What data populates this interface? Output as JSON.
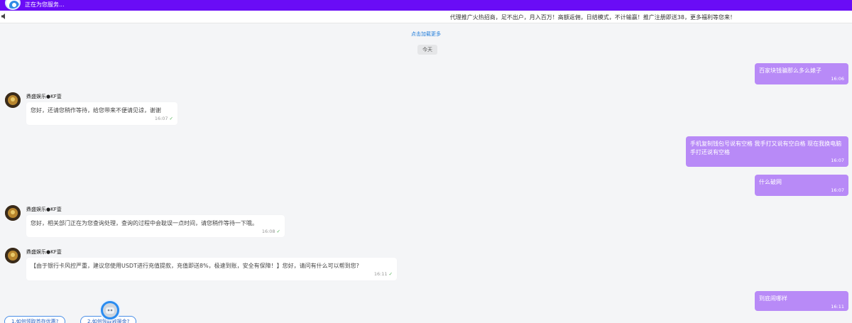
{
  "header": {
    "status": "正在为您服务..."
  },
  "marquee": {
    "text": "代理推广火热招商，足不出户，月入百万！高额返佣，日结模式，不计输赢！推广注册即送38，更多福利等您来！"
  },
  "history": {
    "load_more": "点击加载更多",
    "date_label": "今天"
  },
  "agent": {
    "name": "鼎盛娱乐●KF壹"
  },
  "messages": [
    {
      "from": "user",
      "text": "百家块钱骗那么多么婊子",
      "time": "16:06"
    },
    {
      "from": "agent",
      "text": "您好，还请您稍作等待，给您带来不便请见谅，谢谢",
      "time": "16:07",
      "read": "✓"
    },
    {
      "from": "user",
      "text": "手机复制钱包号说有空格 我手打又说有空白格 现在我换电脑手打还说有空格",
      "time": "16:07"
    },
    {
      "from": "user",
      "text": "什么破网",
      "time": "16:07"
    },
    {
      "from": "agent",
      "text": "您好，相关部门正在为您查询处理，查询的过程中会耽误一点时间，请您稍作等待一下哦。",
      "time": "16:08",
      "read": "✓"
    },
    {
      "from": "agent",
      "text": "【由于银行卡风控严重，建议您使用USDT进行充值提款，充值即送8%，极速到账，安全有保障！】您好，请问有什么可以帮到您?",
      "time": "16:11",
      "read": "✓"
    },
    {
      "from": "user",
      "text": "到底闹哪样",
      "time": "16:11"
    }
  ],
  "quick_replies": [
    "1.如何领取首存优惠?",
    "2.如何领取救援金?"
  ],
  "colors": {
    "header_bg": "#6a0cf6",
    "user_bubble": "#b88af7",
    "link": "#1e7bd9"
  }
}
